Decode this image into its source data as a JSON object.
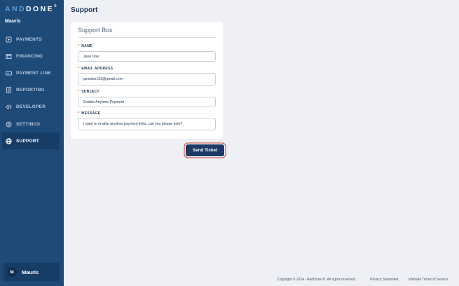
{
  "brand": {
    "logo_left": "AND",
    "logo_right": "DONE",
    "logo_mark": "®"
  },
  "sidebar": {
    "org_name": "Mauris",
    "items": [
      {
        "label": "PAYMENTS",
        "icon": "payments-icon"
      },
      {
        "label": "FINANCING",
        "icon": "financing-icon"
      },
      {
        "label": "PAYMENT LINK",
        "icon": "payment-link-icon"
      },
      {
        "label": "REPORTING",
        "icon": "reporting-icon"
      },
      {
        "label": "DEVELOPER",
        "icon": "code-icon"
      },
      {
        "label": "SETTINGS",
        "icon": "gear-icon"
      },
      {
        "label": "SUPPORT",
        "icon": "globe-icon",
        "active": true
      }
    ],
    "user": {
      "initial": "M",
      "name": "Mauris"
    }
  },
  "page": {
    "title": "Support"
  },
  "form": {
    "title": "Support Box",
    "required_mark": "*",
    "name": {
      "label": "NAME",
      "value": "Jane Doe"
    },
    "email": {
      "label": "EMAIL ADDRESS",
      "value": "janedoe123@gmail.com"
    },
    "subject": {
      "label": "SUBJECT",
      "value": "Enable Anytime Payment"
    },
    "message": {
      "label": "MESSAGE",
      "value": "I want to enable anytime payment links, can you please help?"
    },
    "submit_label": "Send Ticket"
  },
  "footer": {
    "copyright": "Copyright © 2024 - AndDone ®. All rights reserved.",
    "privacy": "Privacy Statement",
    "terms": "Website Terms of Service"
  },
  "colors": {
    "sidebar": "#1e4a78",
    "accent": "#1e3a64",
    "highlight": "#c0392b",
    "background": "#eef0f5"
  }
}
